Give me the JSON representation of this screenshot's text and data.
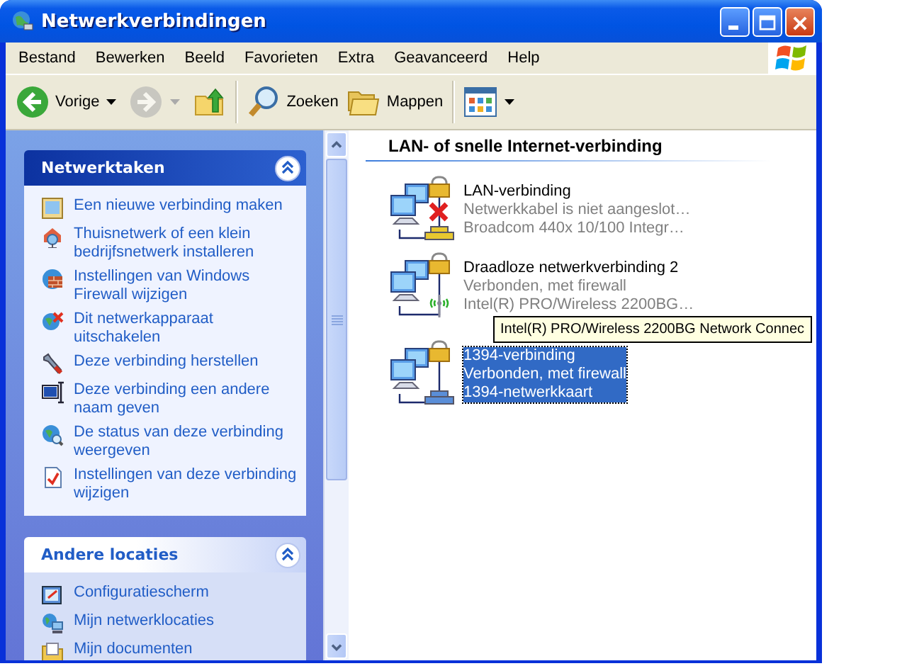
{
  "window": {
    "title": "Netwerkverbindingen"
  },
  "menu": [
    "Bestand",
    "Bewerken",
    "Beeld",
    "Favorieten",
    "Extra",
    "Geavanceerd",
    "Help"
  ],
  "toolbar": [
    {
      "kind": "back",
      "label": "Vorige",
      "disabled": false,
      "dropdown": true
    },
    {
      "kind": "forward",
      "disabled": true,
      "dropdown": true
    },
    {
      "kind": "up",
      "disabled": false,
      "dropdown": false
    },
    {
      "kind": "separator"
    },
    {
      "kind": "search",
      "label": "Zoeken",
      "disabled": false,
      "dropdown": false
    },
    {
      "kind": "folders",
      "label": "Mappen",
      "disabled": false,
      "dropdown": false
    },
    {
      "kind": "separator"
    },
    {
      "kind": "views",
      "disabled": false,
      "dropdown": true
    }
  ],
  "task_panels": [
    {
      "title": "Netwerktaken",
      "kind": "special",
      "expanded": true,
      "items": [
        "Een nieuwe verbinding maken",
        "Thuisnetwerk of een klein bedrijfsnetwerk installeren",
        "Instellingen van Windows Firewall wijzigen",
        "Dit netwerkapparaat uitschakelen",
        "Deze verbinding herstellen",
        "Deze verbinding een andere naam geven",
        "De status van deze verbinding weergeven",
        "Instellingen van deze verbinding wijzigen"
      ]
    },
    {
      "title": "Andere locaties",
      "kind": "normal",
      "expanded": true,
      "items": [
        "Configuratiescherm",
        "Mijn netwerklocaties",
        "Mijn documenten"
      ]
    }
  ],
  "group": {
    "title": "LAN- of snelle Internet-verbinding",
    "connections": [
      {
        "kind": "wired",
        "name": "LAN-verbinding",
        "status": "Netwerkkabel is niet aangeslot…",
        "device": "Broadcom 440x 10/100 Integr…",
        "disconnected": true,
        "selected": false
      },
      {
        "kind": "wireless",
        "name": "Draadloze netwerkverbinding 2",
        "status": "Verbonden, met firewall",
        "device": "Intel(R) PRO/Wireless 2200BG…",
        "disconnected": false,
        "selected": false
      },
      {
        "kind": "wired",
        "name": "1394-verbinding",
        "status": "Verbonden, met firewall",
        "device": "1394-netwerkkaart",
        "disconnected": false,
        "selected": true
      }
    ]
  },
  "tooltip": {
    "text": "Intel(R) PRO/Wireless 2200BG Network Connec"
  }
}
